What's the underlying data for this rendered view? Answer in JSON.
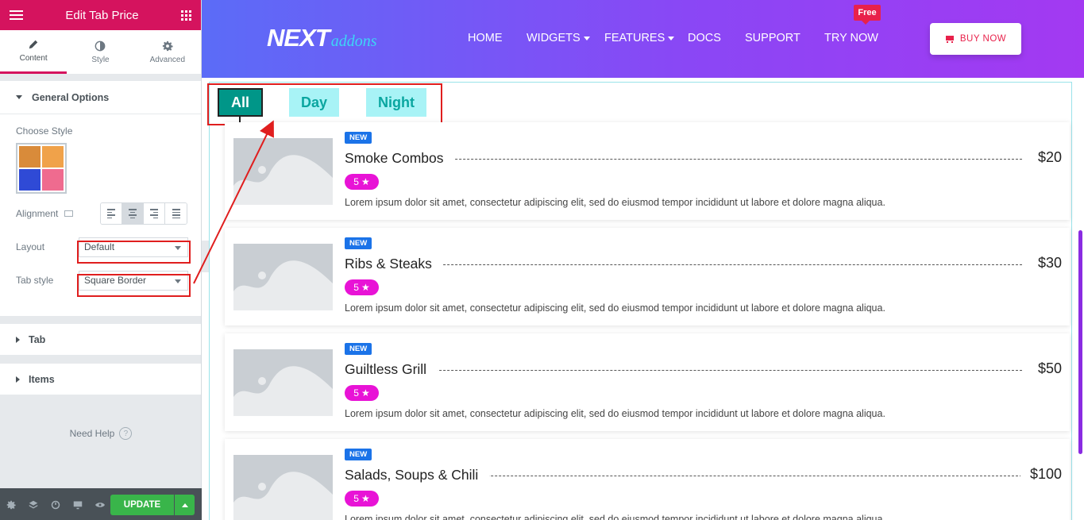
{
  "panel": {
    "title": "Edit Tab Price",
    "tabs": [
      {
        "label": "Content"
      },
      {
        "label": "Style"
      },
      {
        "label": "Advanced"
      }
    ],
    "general_options": {
      "label": "General Options",
      "choose_style_label": "Choose Style",
      "alignment_label": "Alignment",
      "layout_label": "Layout",
      "layout_value": "Default",
      "tab_style_label": "Tab style",
      "tab_style_value": "Square Border"
    },
    "sections": [
      {
        "label": "Tab"
      },
      {
        "label": "Items"
      }
    ],
    "need_help": "Need Help",
    "update_label": "UPDATE"
  },
  "site": {
    "logo_next": "NEXT",
    "logo_addons": "addons",
    "nav": [
      {
        "label": "HOME"
      },
      {
        "label": "WIDGETS"
      },
      {
        "label": "FEATURES"
      },
      {
        "label": "DOCS"
      },
      {
        "label": "SUPPORT"
      },
      {
        "label": "TRY NOW"
      }
    ],
    "free_badge": "Free",
    "buy_label": "BUY NOW"
  },
  "tabs": [
    {
      "label": "All"
    },
    {
      "label": "Day"
    },
    {
      "label": "Night"
    }
  ],
  "items": [
    {
      "badge": "NEW",
      "title": "Smoke Combos",
      "price": "$20",
      "rating": "5",
      "desc": "Lorem ipsum dolor sit amet, consectetur adipiscing elit, sed do eiusmod tempor incididunt ut labore et dolore magna aliqua."
    },
    {
      "badge": "NEW",
      "title": "Ribs & Steaks",
      "price": "$30",
      "rating": "5",
      "desc": "Lorem ipsum dolor sit amet, consectetur adipiscing elit, sed do eiusmod tempor incididunt ut labore et dolore magna aliqua."
    },
    {
      "badge": "NEW",
      "title": "Guiltless Grill",
      "price": "$50",
      "rating": "5",
      "desc": "Lorem ipsum dolor sit amet, consectetur adipiscing elit, sed do eiusmod tempor incididunt ut labore et dolore magna aliqua."
    },
    {
      "badge": "NEW",
      "title": "Salads, Soups & Chili",
      "price": "$100",
      "rating": "5",
      "desc": "Lorem ipsum dolor sit amet, consectetur adipiscing elit, sed do eiusmod tempor incididunt ut labore et dolore magna aliqua."
    }
  ],
  "colors": {
    "panel_accent": "#d5135e",
    "header_gradient_start": "#5b6cf7",
    "header_gradient_end": "#a339f2",
    "tab_active": "#009688",
    "tab_inactive": "#a8f3f6",
    "badge_new": "#1b73e8",
    "rating": "#e813d6",
    "annotation": "#e01e1e",
    "update_button": "#39b54a"
  },
  "icons": [
    "hamburger-icon",
    "apps-grid-icon",
    "pencil-icon",
    "contrast-icon",
    "gear-icon",
    "monitor-icon",
    "help-icon",
    "settings-icon",
    "layers-icon",
    "history-icon",
    "responsive-icon",
    "eye-icon",
    "cart-icon",
    "star-icon",
    "image-placeholder-icon"
  ]
}
